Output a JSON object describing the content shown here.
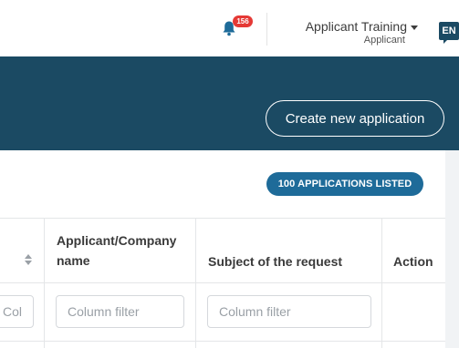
{
  "header": {
    "notifications_count": "156",
    "user_name": "Applicant Training",
    "user_role": "Applicant",
    "language": "EN"
  },
  "banner": {
    "create_button_label": "Create new application"
  },
  "table": {
    "listed_count_label": "100 APPLICATIONS LISTED",
    "columns": [
      {
        "label": "Applicant/Company name"
      },
      {
        "label": "Subject of the request"
      },
      {
        "label": "Action"
      }
    ],
    "filter_placeholder": "Column filter"
  },
  "colors": {
    "brand_dark": "#1b4a63",
    "pill_blue": "#1e6b99",
    "badge_red": "#e53935"
  },
  "icons": [
    "bell-icon",
    "caret-down-icon",
    "sort-icon"
  ]
}
